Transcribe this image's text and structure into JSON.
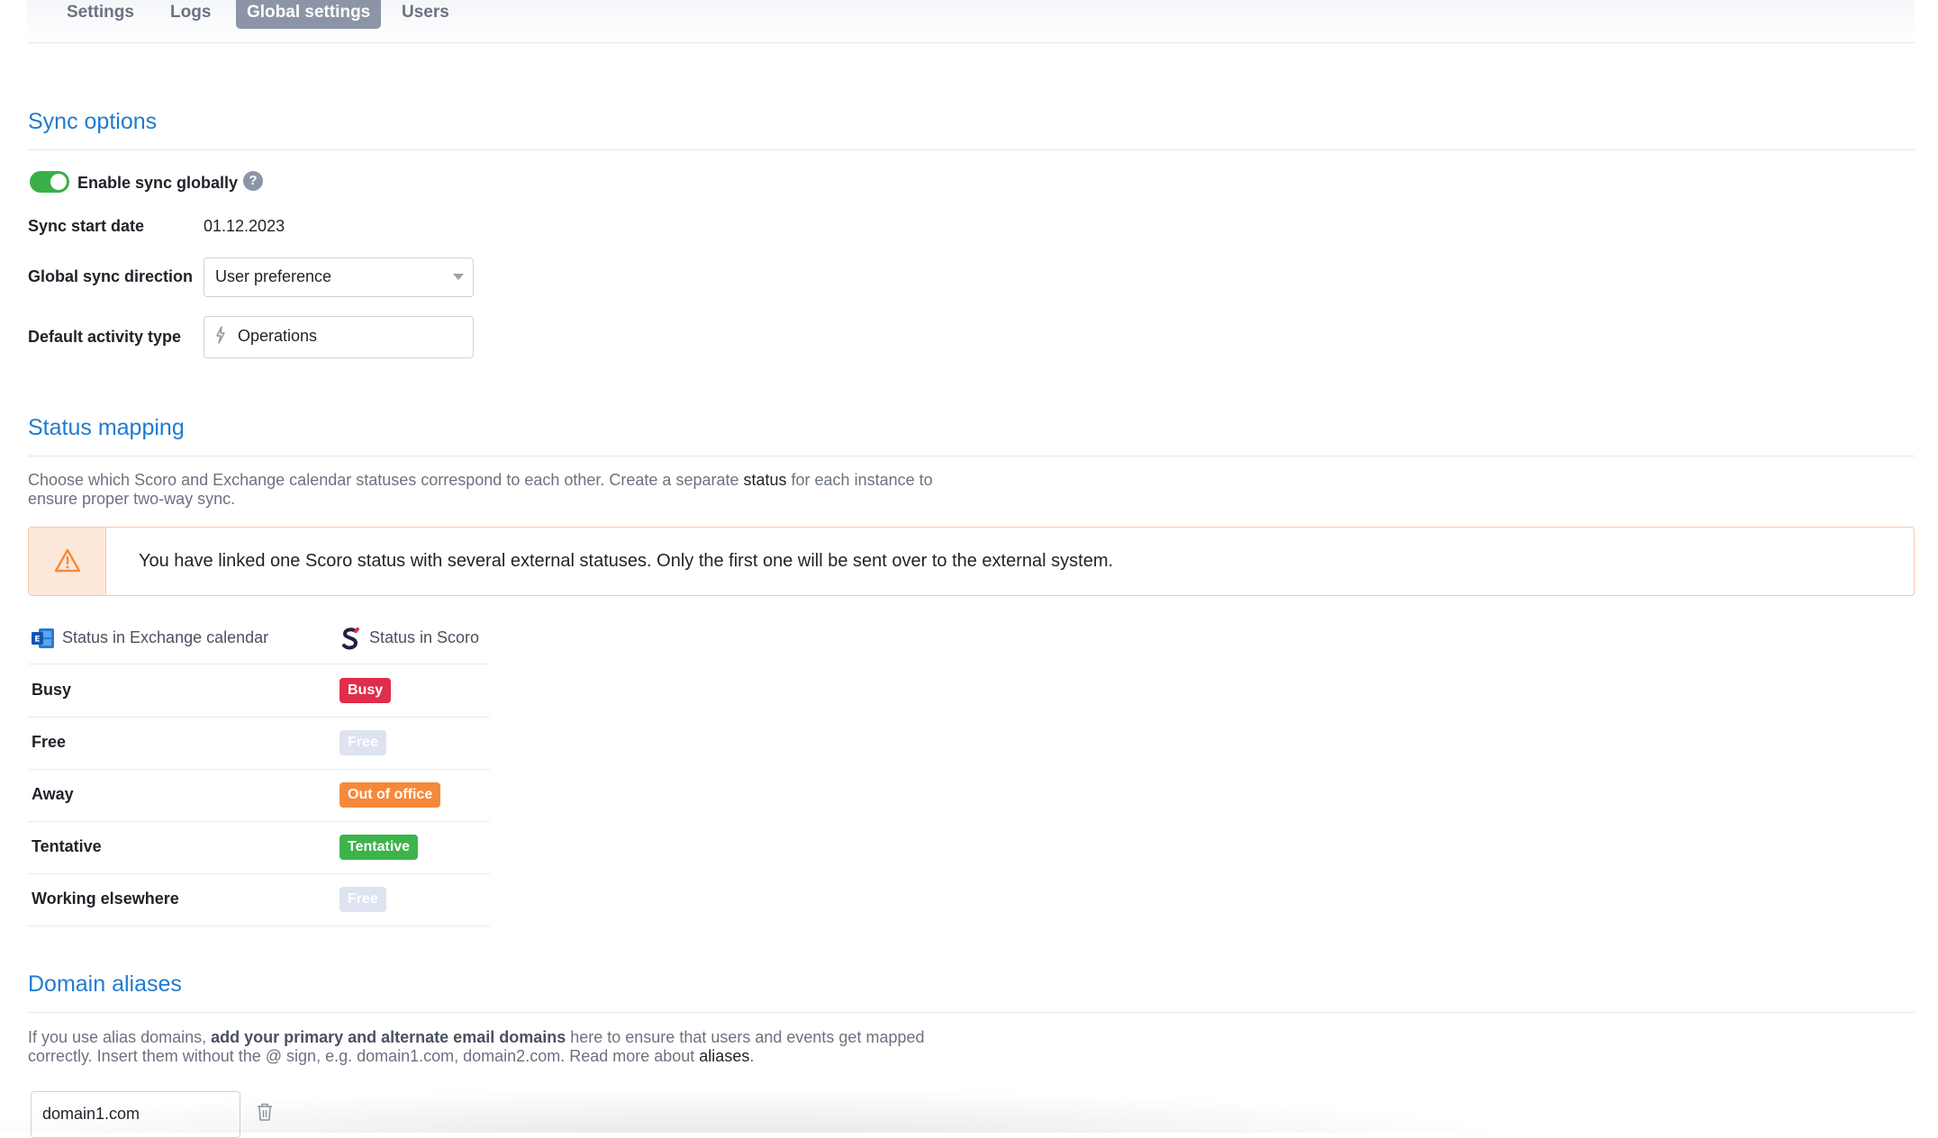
{
  "tabs": [
    {
      "label": "Settings",
      "active": false
    },
    {
      "label": "Logs",
      "active": false
    },
    {
      "label": "Global settings",
      "active": true
    },
    {
      "label": "Users",
      "active": false
    }
  ],
  "sync_options": {
    "title": "Sync options",
    "enable_sync_label": "Enable sync globally",
    "enable_sync_on": true,
    "help_glyph": "?",
    "sync_start_date_label": "Sync start date",
    "sync_start_date_value": "01.12.2023",
    "global_sync_direction_label": "Global sync direction",
    "global_sync_direction_value": "User preference",
    "default_activity_type_label": "Default activity type",
    "default_activity_type_value": "Operations",
    "activity_icon": "bolt-icon"
  },
  "status_mapping": {
    "title": "Status mapping",
    "desc_line1_pre": "Choose which Scoro and Exchange calendar statuses correspond to each other. Create a separate ",
    "desc_line1_link": "status",
    "desc_line1_post": " for each instance to",
    "desc_line2": "ensure proper two-way sync.",
    "warning": "You have linked one Scoro status with several external statuses. Only the first one will be sent over to the external system.",
    "col_exchange": "Status in Exchange calendar",
    "col_scoro": "Status in Scoro",
    "rows": [
      {
        "exchange": "Busy",
        "scoro": "Busy",
        "color": "#e02d4b"
      },
      {
        "exchange": "Free",
        "scoro": "Free",
        "color": "#dde3ef"
      },
      {
        "exchange": "Away",
        "scoro": "Out of office",
        "color": "#f5893b"
      },
      {
        "exchange": "Tentative",
        "scoro": "Tentative",
        "color": "#3cb44a"
      },
      {
        "exchange": "Working elsewhere",
        "scoro": "Free",
        "color": "#dde3ef"
      }
    ]
  },
  "domain_aliases": {
    "title": "Domain aliases",
    "desc_line1_pre": "If you use alias domains, ",
    "desc_line1_bold": "add your primary and alternate email domains",
    "desc_line1_post": " here to ensure that users and events get mapped",
    "desc_line2_pre": "correctly. Insert them without the @ sign, e.g. domain1.com, domain2.com. Read more about ",
    "desc_line2_link": "aliases",
    "desc_line2_post": ".",
    "domain_value": "domain1.com"
  },
  "colors": {
    "accent_blue": "#1f7bd0",
    "toggle_on": "#38b047",
    "warning_orange": "#f5893b"
  }
}
